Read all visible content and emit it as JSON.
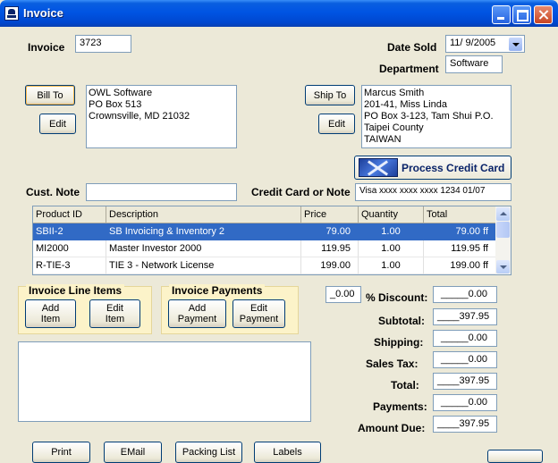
{
  "window": {
    "title": "Invoice"
  },
  "invoice": {
    "label": "Invoice",
    "number": "3723"
  },
  "date_sold": {
    "label": "Date Sold",
    "value": "11/ 9/2005"
  },
  "department": {
    "label": "Department",
    "value": "Software"
  },
  "bill_to": {
    "button": "Bill To",
    "edit": "Edit",
    "lines": [
      "OWL Software",
      "PO Box 513",
      "Crownsville, MD  21032"
    ]
  },
  "ship_to": {
    "button": "Ship To",
    "edit": "Edit",
    "lines": [
      "Marcus Smith",
      "201-41, Miss Linda",
      "PO Box 3-123, Tam Shui P.O.",
      "Taipei County",
      "TAIWAN"
    ]
  },
  "credit_card_button": {
    "label": "Process Credit Card",
    "icon": "charge-card-icon"
  },
  "cust_note": {
    "label": "Cust. Note",
    "value": ""
  },
  "cc_note": {
    "label": "Credit Card or Note",
    "value": "Visa xxxx xxxx xxxx 1234 01/07"
  },
  "line_items_table": {
    "columns": [
      "Product ID",
      "Description",
      "Price",
      "Quantity",
      "Total"
    ],
    "rows": [
      {
        "product_id": "SBII-2",
        "description": "SB Invoicing & Inventory 2",
        "price": "79.00",
        "quantity": "1.00",
        "total": "79.00 ff"
      },
      {
        "product_id": "MI2000",
        "description": "Master Investor 2000",
        "price": "119.95",
        "quantity": "1.00",
        "total": "119.95 ff"
      },
      {
        "product_id": "R-TIE-3",
        "description": "TIE 3 - Network License",
        "price": "199.00",
        "quantity": "1.00",
        "total": "199.00 ff"
      }
    ]
  },
  "line_items_group": {
    "title": "Invoice Line Items",
    "add": "Add Item",
    "edit": "Edit Item"
  },
  "payments_group": {
    "title": "Invoice Payments",
    "add": "Add Payment",
    "edit": "Edit Payment"
  },
  "discount": {
    "label": "% Discount:",
    "percent": "_0.00",
    "value": "_____0.00"
  },
  "subtotal": {
    "label": "Subtotal:",
    "value": "____397.95"
  },
  "shipping": {
    "label": "Shipping:",
    "value": "_____0.00"
  },
  "sales_tax": {
    "label": "Sales Tax:",
    "value": "_____0.00"
  },
  "total": {
    "label": "Total:",
    "value": "____397.95"
  },
  "payments": {
    "label": "Payments:",
    "value": "_____0.00"
  },
  "amount_due": {
    "label": "Amount Due:",
    "value": "____397.95"
  },
  "bottom_buttons": {
    "print": "Print",
    "email": "EMail",
    "packing_list": "Packing List",
    "labels": "Labels"
  },
  "colors": {
    "titlebar": "#0054e3",
    "selection": "#316ac5",
    "group_bg": "#fcf3c9",
    "window_bg": "#ece9d8"
  }
}
